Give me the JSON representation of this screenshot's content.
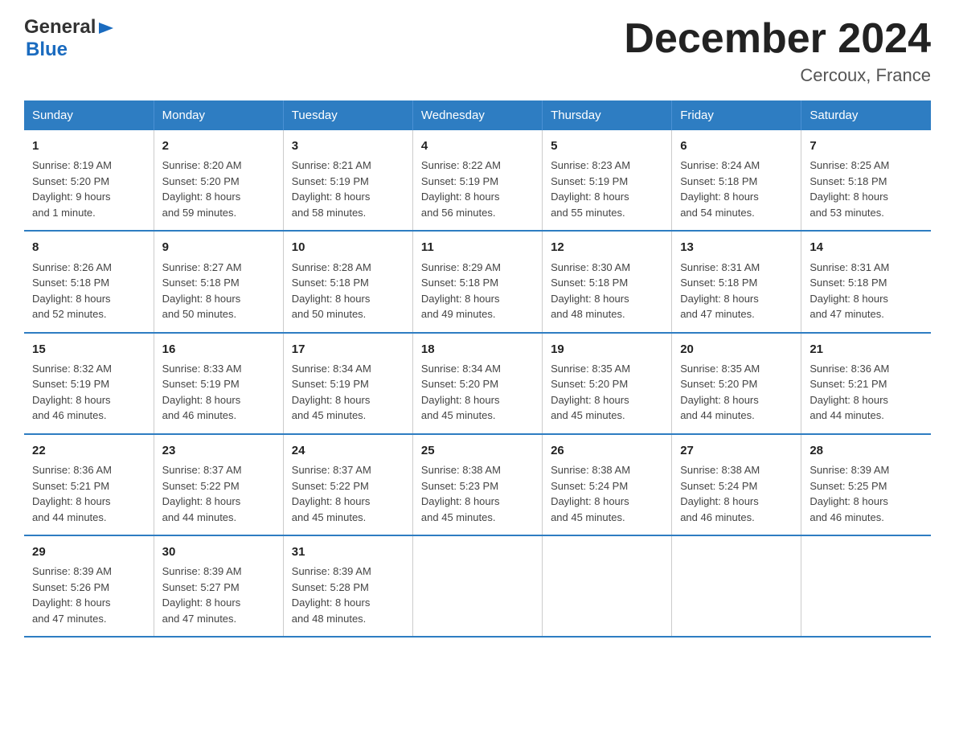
{
  "logo": {
    "general": "General",
    "blue": "Blue"
  },
  "title": "December 2024",
  "subtitle": "Cercoux, France",
  "days_of_week": [
    "Sunday",
    "Monday",
    "Tuesday",
    "Wednesday",
    "Thursday",
    "Friday",
    "Saturday"
  ],
  "weeks": [
    [
      {
        "day": "1",
        "sunrise": "8:19 AM",
        "sunset": "5:20 PM",
        "daylight": "9 hours and 1 minute."
      },
      {
        "day": "2",
        "sunrise": "8:20 AM",
        "sunset": "5:20 PM",
        "daylight": "8 hours and 59 minutes."
      },
      {
        "day": "3",
        "sunrise": "8:21 AM",
        "sunset": "5:19 PM",
        "daylight": "8 hours and 58 minutes."
      },
      {
        "day": "4",
        "sunrise": "8:22 AM",
        "sunset": "5:19 PM",
        "daylight": "8 hours and 56 minutes."
      },
      {
        "day": "5",
        "sunrise": "8:23 AM",
        "sunset": "5:19 PM",
        "daylight": "8 hours and 55 minutes."
      },
      {
        "day": "6",
        "sunrise": "8:24 AM",
        "sunset": "5:18 PM",
        "daylight": "8 hours and 54 minutes."
      },
      {
        "day": "7",
        "sunrise": "8:25 AM",
        "sunset": "5:18 PM",
        "daylight": "8 hours and 53 minutes."
      }
    ],
    [
      {
        "day": "8",
        "sunrise": "8:26 AM",
        "sunset": "5:18 PM",
        "daylight": "8 hours and 52 minutes."
      },
      {
        "day": "9",
        "sunrise": "8:27 AM",
        "sunset": "5:18 PM",
        "daylight": "8 hours and 50 minutes."
      },
      {
        "day": "10",
        "sunrise": "8:28 AM",
        "sunset": "5:18 PM",
        "daylight": "8 hours and 50 minutes."
      },
      {
        "day": "11",
        "sunrise": "8:29 AM",
        "sunset": "5:18 PM",
        "daylight": "8 hours and 49 minutes."
      },
      {
        "day": "12",
        "sunrise": "8:30 AM",
        "sunset": "5:18 PM",
        "daylight": "8 hours and 48 minutes."
      },
      {
        "day": "13",
        "sunrise": "8:31 AM",
        "sunset": "5:18 PM",
        "daylight": "8 hours and 47 minutes."
      },
      {
        "day": "14",
        "sunrise": "8:31 AM",
        "sunset": "5:18 PM",
        "daylight": "8 hours and 47 minutes."
      }
    ],
    [
      {
        "day": "15",
        "sunrise": "8:32 AM",
        "sunset": "5:19 PM",
        "daylight": "8 hours and 46 minutes."
      },
      {
        "day": "16",
        "sunrise": "8:33 AM",
        "sunset": "5:19 PM",
        "daylight": "8 hours and 46 minutes."
      },
      {
        "day": "17",
        "sunrise": "8:34 AM",
        "sunset": "5:19 PM",
        "daylight": "8 hours and 45 minutes."
      },
      {
        "day": "18",
        "sunrise": "8:34 AM",
        "sunset": "5:20 PM",
        "daylight": "8 hours and 45 minutes."
      },
      {
        "day": "19",
        "sunrise": "8:35 AM",
        "sunset": "5:20 PM",
        "daylight": "8 hours and 45 minutes."
      },
      {
        "day": "20",
        "sunrise": "8:35 AM",
        "sunset": "5:20 PM",
        "daylight": "8 hours and 44 minutes."
      },
      {
        "day": "21",
        "sunrise": "8:36 AM",
        "sunset": "5:21 PM",
        "daylight": "8 hours and 44 minutes."
      }
    ],
    [
      {
        "day": "22",
        "sunrise": "8:36 AM",
        "sunset": "5:21 PM",
        "daylight": "8 hours and 44 minutes."
      },
      {
        "day": "23",
        "sunrise": "8:37 AM",
        "sunset": "5:22 PM",
        "daylight": "8 hours and 44 minutes."
      },
      {
        "day": "24",
        "sunrise": "8:37 AM",
        "sunset": "5:22 PM",
        "daylight": "8 hours and 45 minutes."
      },
      {
        "day": "25",
        "sunrise": "8:38 AM",
        "sunset": "5:23 PM",
        "daylight": "8 hours and 45 minutes."
      },
      {
        "day": "26",
        "sunrise": "8:38 AM",
        "sunset": "5:24 PM",
        "daylight": "8 hours and 45 minutes."
      },
      {
        "day": "27",
        "sunrise": "8:38 AM",
        "sunset": "5:24 PM",
        "daylight": "8 hours and 46 minutes."
      },
      {
        "day": "28",
        "sunrise": "8:39 AM",
        "sunset": "5:25 PM",
        "daylight": "8 hours and 46 minutes."
      }
    ],
    [
      {
        "day": "29",
        "sunrise": "8:39 AM",
        "sunset": "5:26 PM",
        "daylight": "8 hours and 47 minutes."
      },
      {
        "day": "30",
        "sunrise": "8:39 AM",
        "sunset": "5:27 PM",
        "daylight": "8 hours and 47 minutes."
      },
      {
        "day": "31",
        "sunrise": "8:39 AM",
        "sunset": "5:28 PM",
        "daylight": "8 hours and 48 minutes."
      },
      null,
      null,
      null,
      null
    ]
  ],
  "labels": {
    "sunrise": "Sunrise:",
    "sunset": "Sunset:",
    "daylight": "Daylight:"
  }
}
